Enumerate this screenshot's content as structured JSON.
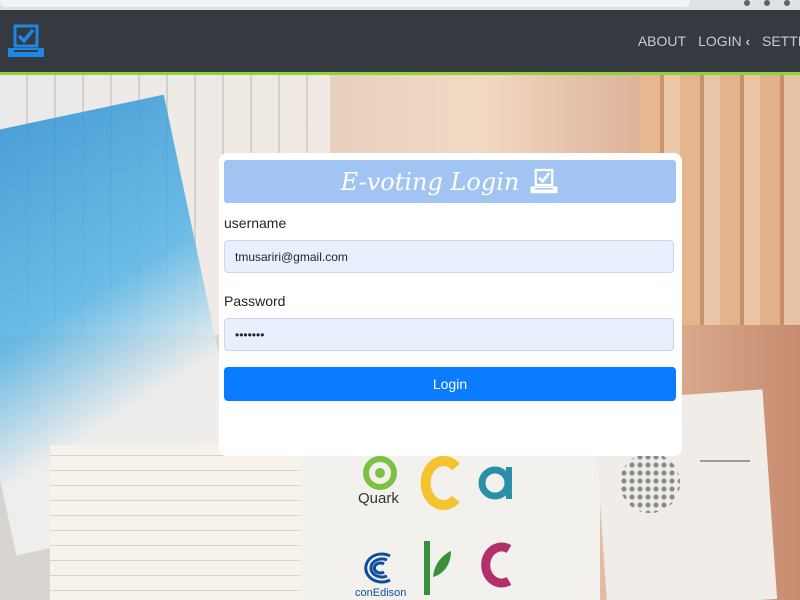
{
  "navbar": {
    "links": [
      "ABOUT",
      "LOGIN",
      "SETTINGS"
    ]
  },
  "login": {
    "title": "E-voting Login",
    "username_label": "username",
    "username_value": "tmusariri@gmail.com",
    "password_label": "Password",
    "password_value": "•••••••",
    "button_label": "Login"
  },
  "background": {
    "logos": [
      "Quark",
      "conEdison"
    ]
  },
  "colors": {
    "navbar_bg": "#343a40",
    "navbar_accent": "#8ed339",
    "brand": "#1e88e5",
    "card_header": "#a2c4f2",
    "input_bg": "#e8f0fe",
    "button": "#0a7cff"
  },
  "icons": {
    "brand": "ballot-box-check-icon",
    "title": "ballot-box-check-icon",
    "login_chevron": "chevron-left-icon"
  }
}
